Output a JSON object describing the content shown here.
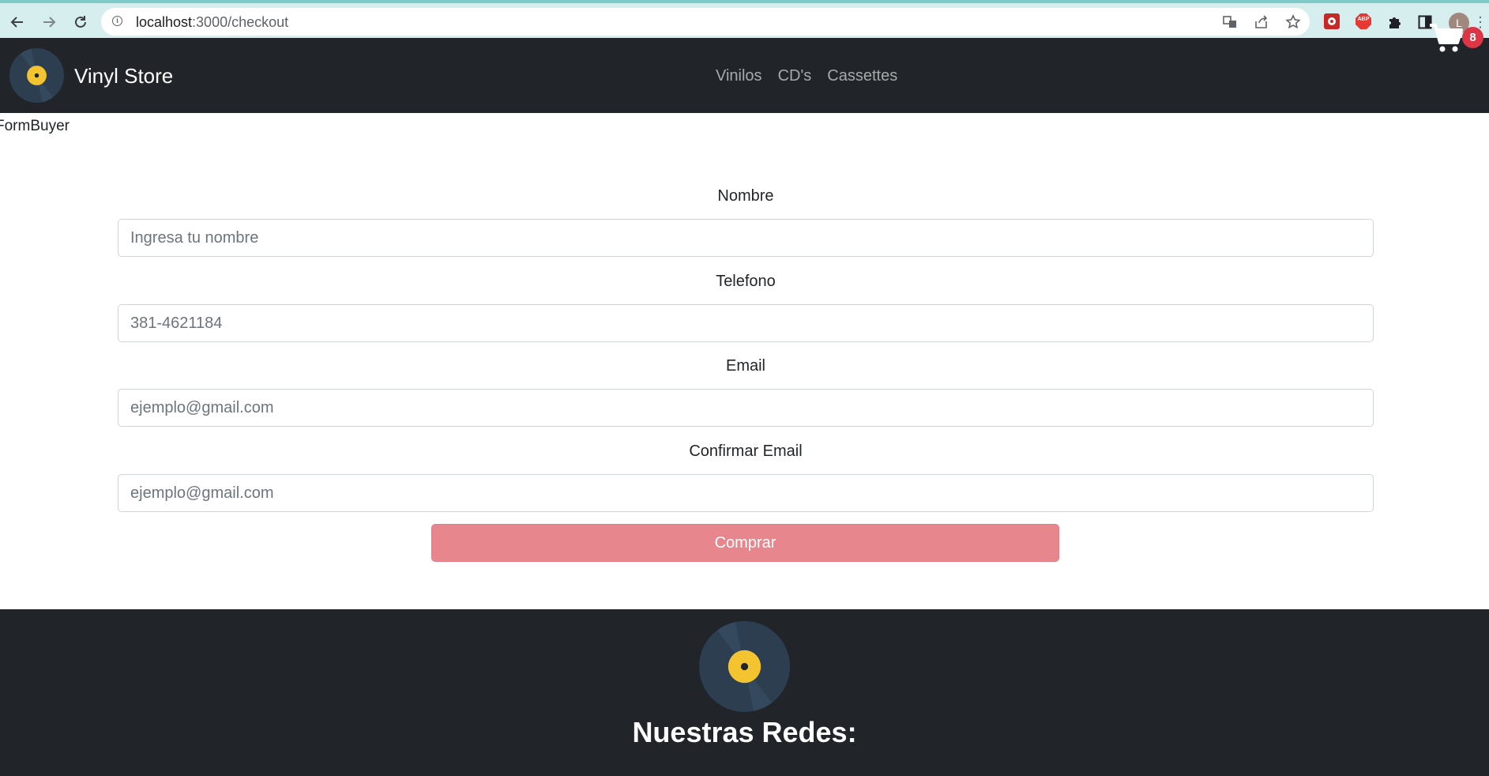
{
  "browser": {
    "url_host": "localhost",
    "url_path": ":3000/checkout",
    "icons": [
      "back-icon",
      "forward-icon",
      "reload-icon",
      "info-icon",
      "translate-icon",
      "share-icon",
      "bookmark-star-icon",
      "extension-icon",
      "adblock-icon",
      "puzzle-icon",
      "side-panel-icon",
      "profile-avatar",
      "menu-icon"
    ],
    "adblock_label": "ABP",
    "profile_initial": "L"
  },
  "navbar": {
    "brand": "Vinyl Store",
    "links": [
      "Vinilos",
      "CD's",
      "Cassettes"
    ],
    "cart_count": "8"
  },
  "page": {
    "debug_label": "FormBuyer"
  },
  "form": {
    "fields": [
      {
        "label": "Nombre",
        "placeholder": "Ingresa tu nombre",
        "value": ""
      },
      {
        "label": "Telefono",
        "placeholder": "381-4621184",
        "value": ""
      },
      {
        "label": "Email",
        "placeholder": "ejemplo@gmail.com",
        "value": ""
      },
      {
        "label": "Confirmar Email",
        "placeholder": "ejemplo@gmail.com",
        "value": ""
      }
    ],
    "submit_label": "Comprar"
  },
  "footer": {
    "title": "Nuestras Redes:"
  },
  "colors": {
    "navbar_bg": "#212529",
    "vinyl_label": "#f4c430",
    "vinyl_disc": "#2c3e50",
    "button_bg": "#e8868e",
    "badge_bg": "#dc3545"
  }
}
